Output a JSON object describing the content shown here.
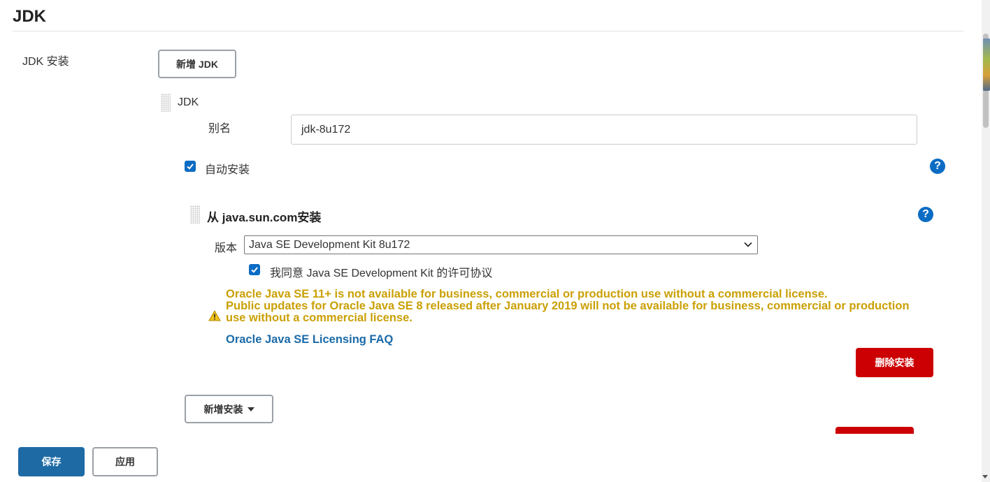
{
  "section": {
    "title": "JDK"
  },
  "jdk_install": {
    "label": "JDK 安装",
    "add_jdk_button": "新增 JDK",
    "item": {
      "header": "JDK",
      "alias_label": "别名",
      "alias_value": "jdk-8u172",
      "auto_install_label": "自动安装",
      "auto_install_checked": true
    },
    "installer": {
      "title": "从 java.sun.com安装",
      "version_label": "版本",
      "version_selected": "Java SE Development Kit 8u172",
      "license_label": "我同意 Java SE Development Kit 的许可协议",
      "license_checked": true,
      "warning_line1": "Oracle Java SE 11+ is not available for business, commercial or production use without a commercial license.",
      "warning_line2": "Public updates for Oracle Java SE 8 released after January 2019 will not be available for business, commercial or production use without a commercial license.",
      "faq_link": "Oracle Java SE Licensing FAQ",
      "delete_install_button": "删除安装"
    },
    "add_installer_button": "新增安装"
  },
  "footer": {
    "save_button": "保存",
    "apply_button": "应用"
  },
  "help_icon_text": "?",
  "colors": {
    "primary": "#1d6aa5",
    "danger": "#cc0003",
    "warning": "#caa005",
    "link": "#1a6aa8",
    "checkbox": "#0b6cc4"
  }
}
